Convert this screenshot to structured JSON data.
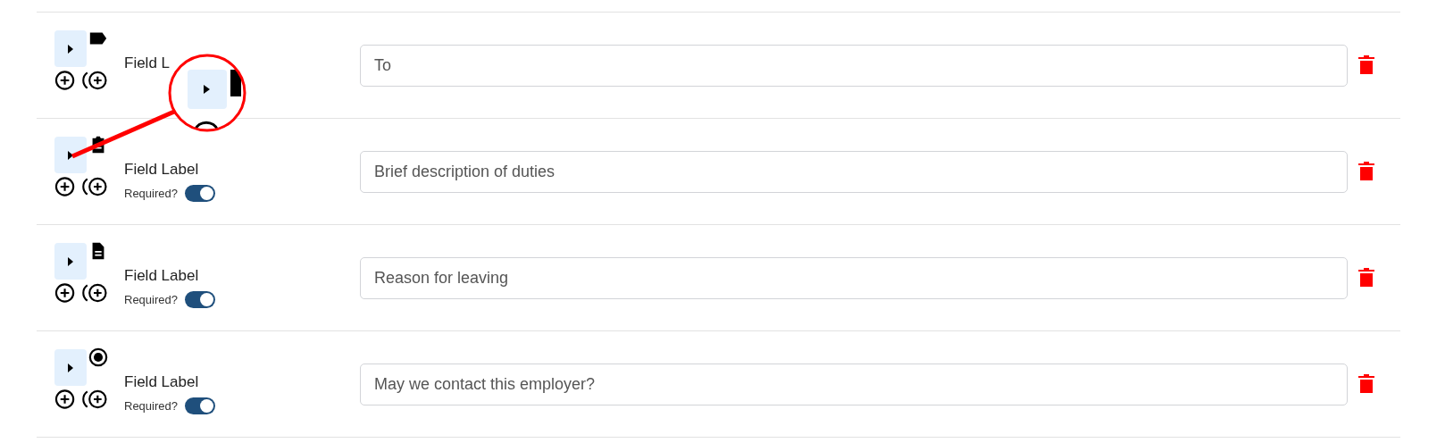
{
  "fields": [
    {
      "kind": "tag",
      "label": "Field L",
      "value": "To"
    },
    {
      "kind": "note",
      "label": "Field Label",
      "value": "Brief description of duties",
      "required_label": "Required?",
      "required": true
    },
    {
      "kind": "document",
      "label": "Field Label",
      "value": "Reason for leaving",
      "required_label": "Required?",
      "required": true
    },
    {
      "kind": "radio",
      "label": "Field Label",
      "value": "May we contact this employer?",
      "required_label": "Required?",
      "required": true
    }
  ]
}
